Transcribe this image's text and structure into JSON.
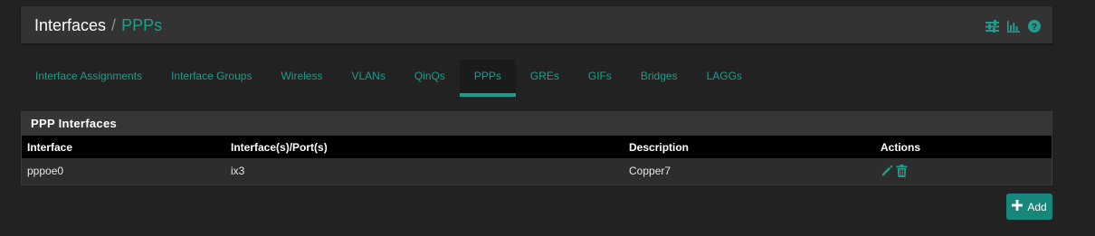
{
  "breadcrumb": {
    "root": "Interfaces",
    "separator": "/",
    "current": "PPPs"
  },
  "header_icons": [
    "sliders-icon",
    "bar-chart-icon",
    "help-icon"
  ],
  "tabs": [
    {
      "label": "Interface Assignments",
      "active": false
    },
    {
      "label": "Interface Groups",
      "active": false
    },
    {
      "label": "Wireless",
      "active": false
    },
    {
      "label": "VLANs",
      "active": false
    },
    {
      "label": "QinQs",
      "active": false
    },
    {
      "label": "PPPs",
      "active": true
    },
    {
      "label": "GREs",
      "active": false
    },
    {
      "label": "GIFs",
      "active": false
    },
    {
      "label": "Bridges",
      "active": false
    },
    {
      "label": "LAGGs",
      "active": false
    }
  ],
  "panel": {
    "title": "PPP Interfaces",
    "columns": [
      "Interface",
      "Interface(s)/Port(s)",
      "Description",
      "Actions"
    ],
    "rows": [
      {
        "interface": "pppoe0",
        "ports": "ix3",
        "description": "Copper7",
        "actions": [
          "edit-icon",
          "delete-icon"
        ]
      }
    ]
  },
  "add_button": {
    "label": "Add",
    "icon": "plus-icon"
  },
  "colors": {
    "accent": "#1e9d8b",
    "button": "#16877a",
    "background": "#222222",
    "panel": "#2d2d2d",
    "table_header": "#000000"
  }
}
